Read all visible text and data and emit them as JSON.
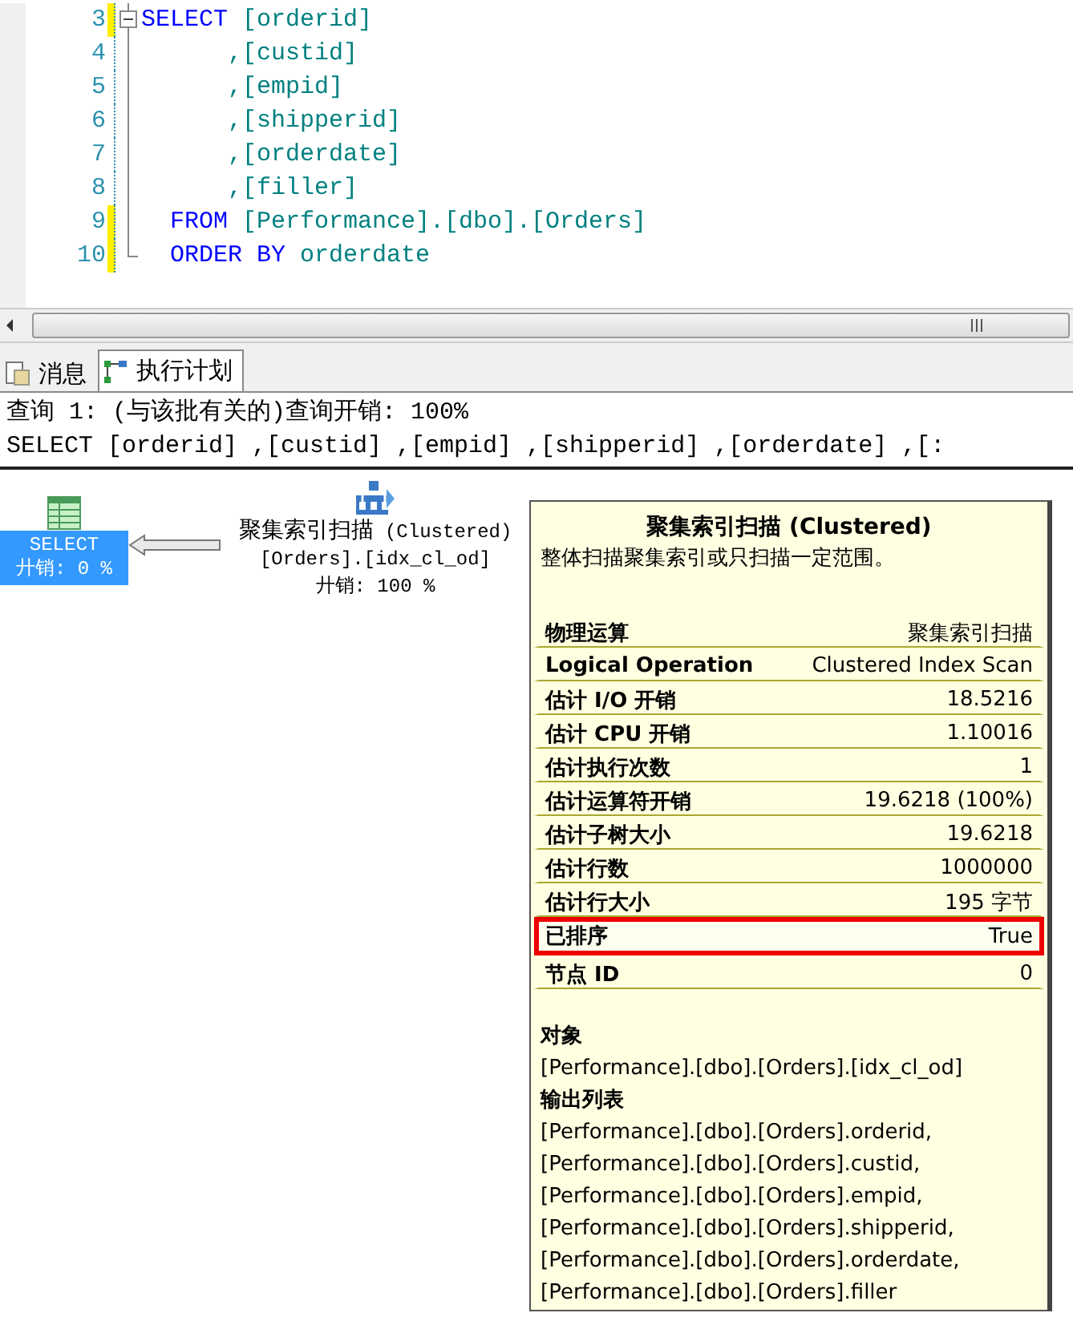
{
  "editor": {
    "lines": [
      {
        "number": "3",
        "changed": true,
        "tokens": [
          {
            "kind": "keyword",
            "text": "SELECT"
          },
          {
            "kind": "ident",
            "text": " [orderid]"
          }
        ]
      },
      {
        "number": "4",
        "changed": false,
        "tokens": [
          {
            "kind": "ident",
            "text": "      ,[custid]"
          }
        ]
      },
      {
        "number": "5",
        "changed": false,
        "tokens": [
          {
            "kind": "ident",
            "text": "      ,[empid]"
          }
        ]
      },
      {
        "number": "6",
        "changed": false,
        "tokens": [
          {
            "kind": "ident",
            "text": "      ,[shipperid]"
          }
        ]
      },
      {
        "number": "7",
        "changed": false,
        "tokens": [
          {
            "kind": "ident",
            "text": "      ,[orderdate]"
          }
        ]
      },
      {
        "number": "8",
        "changed": false,
        "tokens": [
          {
            "kind": "ident",
            "text": "      ,[filler]"
          }
        ]
      },
      {
        "number": "9",
        "changed": true,
        "tokens": [
          {
            "kind": "keyword",
            "text": "  FROM"
          },
          {
            "kind": "ident",
            "text": " [Performance].[dbo].[Orders]"
          }
        ]
      },
      {
        "number": "10",
        "changed": true,
        "tokens": [
          {
            "kind": "keyword",
            "text": "  ORDER BY"
          },
          {
            "kind": "ident",
            "text": " orderdate"
          }
        ]
      }
    ]
  },
  "tabs": [
    {
      "label": "消息",
      "selected": false
    },
    {
      "label": "执行计划",
      "selected": true
    }
  ],
  "query_header": {
    "cost": "查询 1: (与该批有关的)查询开销: 100%",
    "statement": "SELECT [orderid] ,[custid] ,[empid] ,[shipperid] ,[orderdate] ,[:"
  },
  "plan_nodes": [
    {
      "kind": "select",
      "selected": true,
      "title": "SELECT",
      "cost": "廾销: 0 %"
    },
    {
      "kind": "scan",
      "selected": false,
      "title": "聚集索引扫描",
      "subtitle": "(Clustered)",
      "object": "[Orders].[idx_cl_od]",
      "cost": "廾销: 100 %"
    }
  ],
  "tooltip": {
    "title": "聚集索引扫描 (Clustered)",
    "description": "整体扫描聚集索引或只扫描一定范围。",
    "rows": [
      {
        "label": "物理运算",
        "value": "聚集索引扫描",
        "highlighted": false
      },
      {
        "label": "Logical Operation",
        "value": "Clustered Index Scan",
        "highlighted": false
      },
      {
        "label": "估计 I/O 开销",
        "value": "18.5216",
        "highlighted": false
      },
      {
        "label": "估计 CPU 开销",
        "value": "1.10016",
        "highlighted": false
      },
      {
        "label": "估计执行次数",
        "value": "1",
        "highlighted": false
      },
      {
        "label": "估计运算符开销",
        "value": "19.6218 (100%)",
        "highlighted": false
      },
      {
        "label": "估计子树大小",
        "value": "19.6218",
        "highlighted": false
      },
      {
        "label": "估计行数",
        "value": "1000000",
        "highlighted": false
      },
      {
        "label": "估计行大小",
        "value": "195 字节",
        "highlighted": false
      },
      {
        "label": "已排序",
        "value": "True",
        "highlighted": true
      },
      {
        "label": "节点 ID",
        "value": "0",
        "highlighted": false
      }
    ],
    "sections": [
      {
        "heading": "对象",
        "lines": [
          "[Performance].[dbo].[Orders].[idx_cl_od]"
        ]
      },
      {
        "heading": "输出列表",
        "lines": [
          "[Performance].[dbo].[Orders].orderid,",
          "[Performance].[dbo].[Orders].custid,",
          "[Performance].[dbo].[Orders].empid,",
          "[Performance].[dbo].[Orders].shipperid,",
          "[Performance].[dbo].[Orders].orderdate,",
          "[Performance].[dbo].[Orders].filler"
        ]
      }
    ]
  }
}
